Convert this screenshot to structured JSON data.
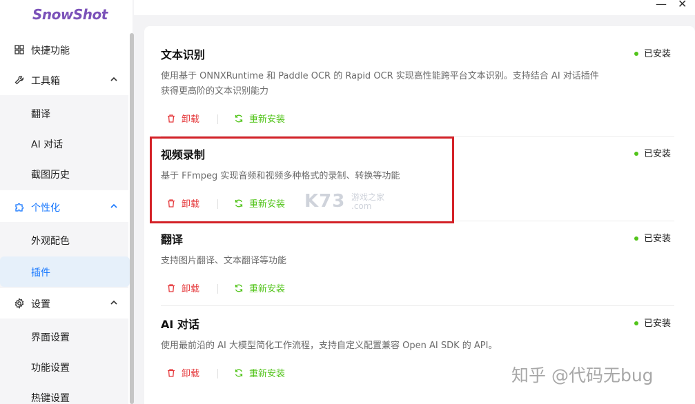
{
  "app": {
    "logo": "SnowShot"
  },
  "window_controls": {
    "minimize": "—",
    "close": "✕"
  },
  "sidebar": {
    "quick": {
      "label": "快捷功能",
      "icon": "grid-icon"
    },
    "toolbox": {
      "label": "工具箱",
      "icon": "wrench-icon",
      "items": [
        "翻译",
        "AI 对话",
        "截图历史"
      ]
    },
    "personalize": {
      "label": "个性化",
      "icon": "puzzle-icon",
      "items": [
        "外观配色",
        "插件"
      ],
      "active_item": "插件"
    },
    "settings": {
      "label": "设置",
      "icon": "gear-icon",
      "items": [
        "界面设置",
        "功能设置",
        "热键设置"
      ]
    }
  },
  "plugins": [
    {
      "title": "文本识别",
      "status": "已安装",
      "desc_lines": [
        "使用基于 ONNXRuntime 和 Paddle OCR 的 Rapid OCR 实现高性能跨平台文本识别。支持结合 AI 对话插件",
        "获得更高阶的文本识别能力"
      ],
      "uninstall": "卸载",
      "reinstall": "重新安装"
    },
    {
      "title": "视频录制",
      "status": "已安装",
      "desc_lines": [
        "基于 FFmpeg 实现音频和视频多种格式的录制、转换等功能"
      ],
      "uninstall": "卸载",
      "reinstall": "重新安装"
    },
    {
      "title": "翻译",
      "status": "已安装",
      "desc_lines": [
        "支持图片翻译、文本翻译等功能"
      ],
      "uninstall": "卸载",
      "reinstall": "重新安装"
    },
    {
      "title": "AI 对话",
      "status": "已安装",
      "desc_lines": [
        "使用最前沿的 AI 大模型简化工作流程，支持自定义配置兼容 Open AI SDK 的 API。"
      ],
      "uninstall": "卸载",
      "reinstall": "重新安装"
    }
  ],
  "watermarks": {
    "k73": "K73",
    "k73_sub_1": "游戏之家",
    "k73_sub_2": ".com",
    "zhihu": "知乎 @代码无bug"
  },
  "colors": {
    "accent": "#1677ff",
    "danger": "#e5393c",
    "success": "#52c41a",
    "logo": "#7b52b9",
    "highlight": "#d42127"
  }
}
